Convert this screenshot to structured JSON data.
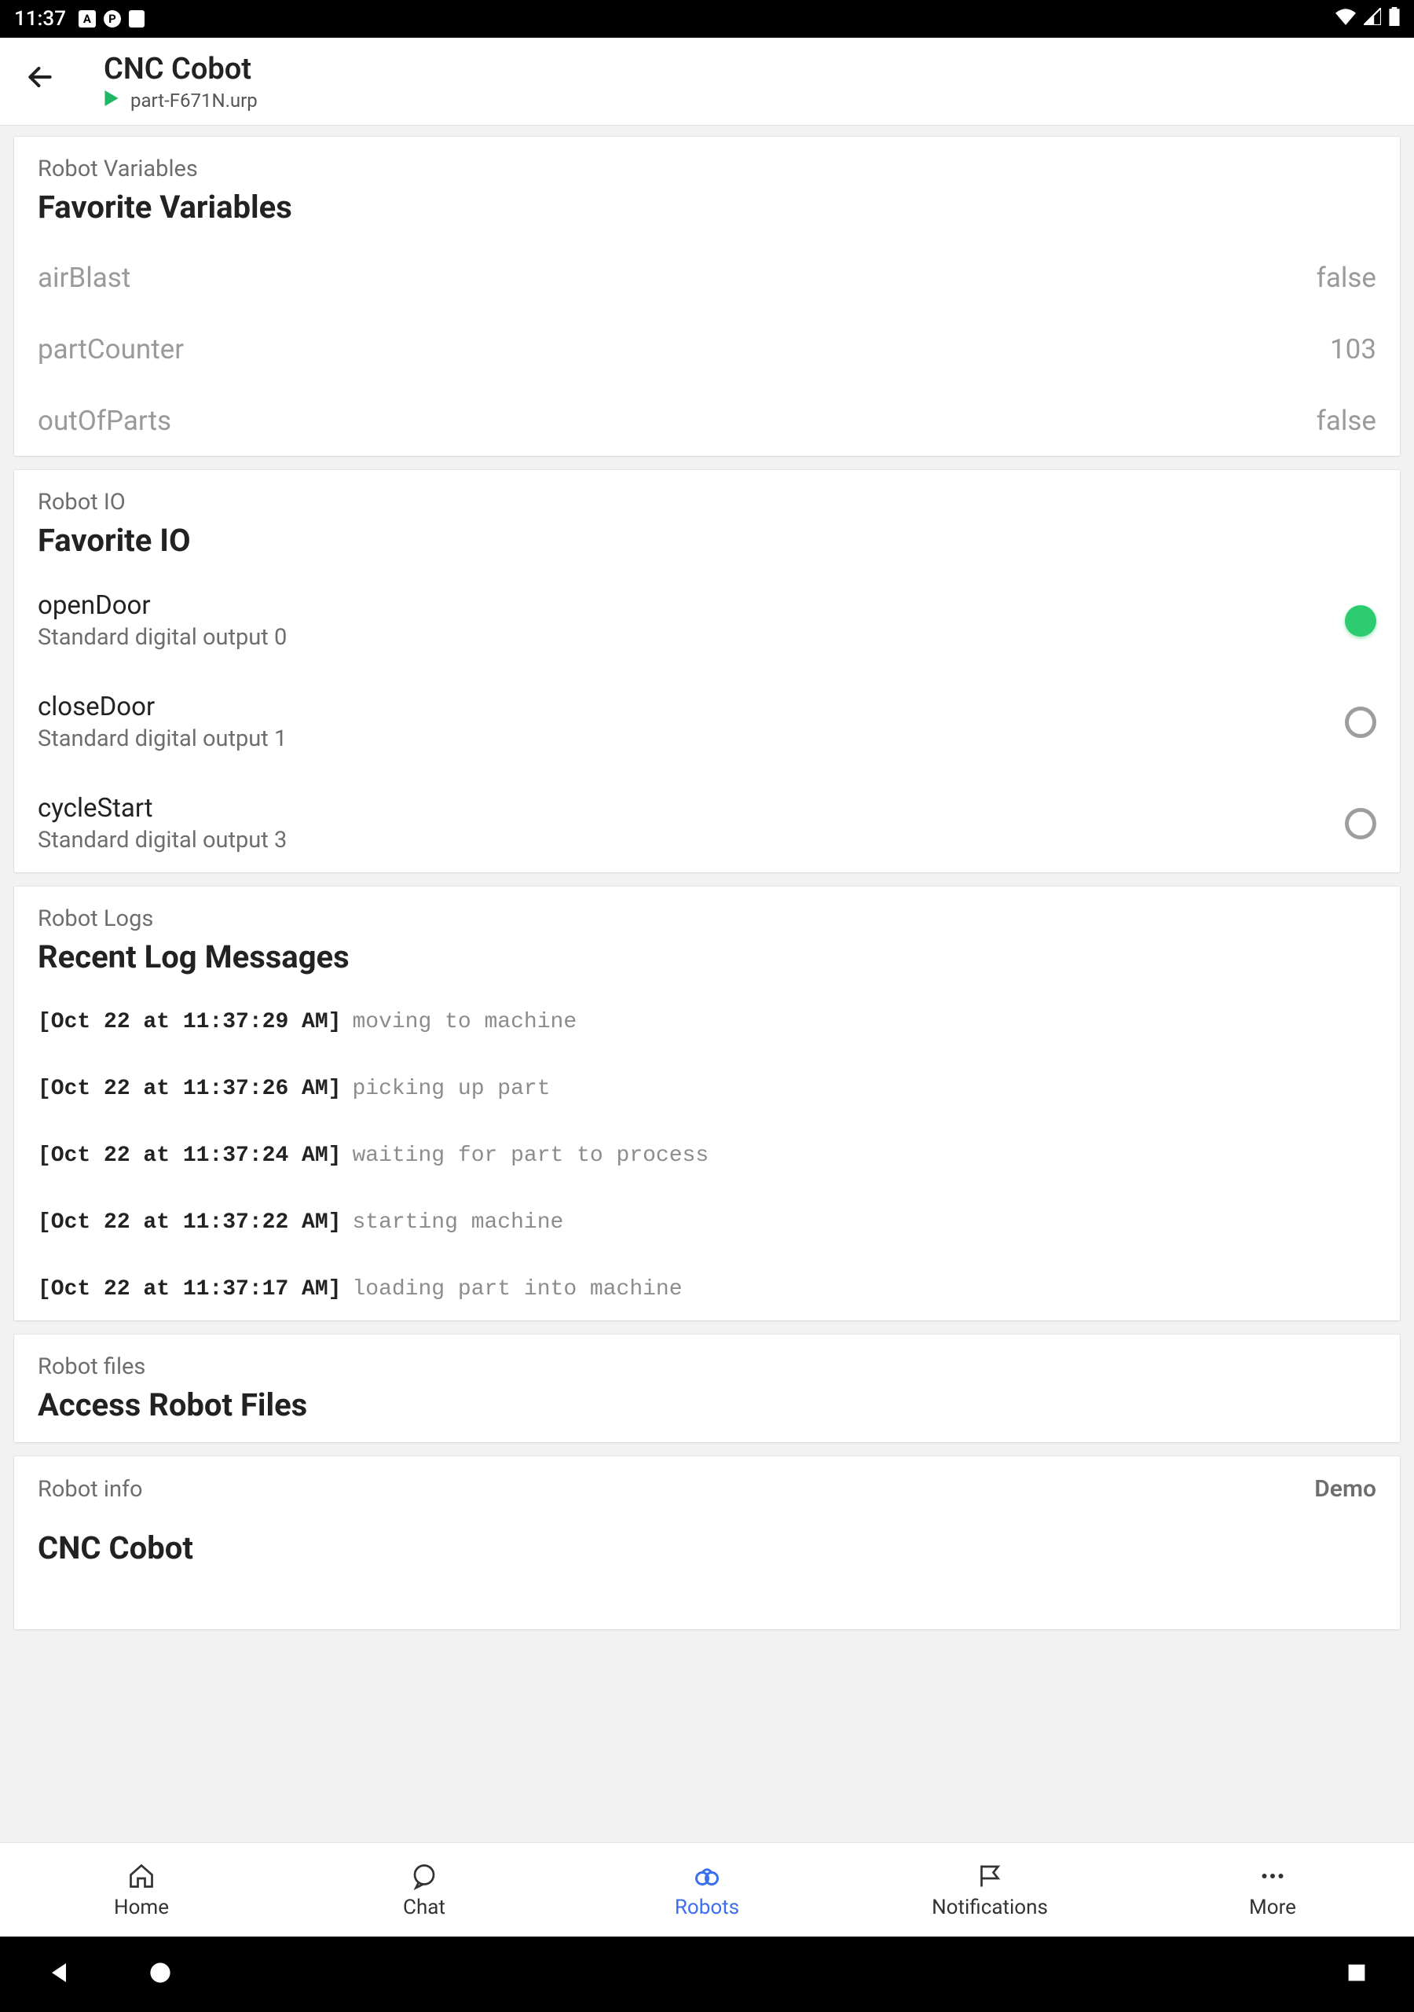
{
  "status": {
    "time": "11:37"
  },
  "header": {
    "title": "CNC Cobot",
    "filename": "part-F671N.urp"
  },
  "variables": {
    "section_label": "Robot Variables",
    "section_title": "Favorite Variables",
    "items": [
      {
        "name": "airBlast",
        "value": "false"
      },
      {
        "name": "partCounter",
        "value": "103"
      },
      {
        "name": "outOfParts",
        "value": "false"
      }
    ]
  },
  "io": {
    "section_label": "Robot IO",
    "section_title": "Favorite IO",
    "items": [
      {
        "name": "openDoor",
        "desc": "Standard digital output 0",
        "on": true
      },
      {
        "name": "closeDoor",
        "desc": "Standard digital output 1",
        "on": false
      },
      {
        "name": "cycleStart",
        "desc": "Standard digital output 3",
        "on": false
      }
    ]
  },
  "logs": {
    "section_label": "Robot Logs",
    "section_title": "Recent Log Messages",
    "items": [
      {
        "ts": "[Oct 22 at 11:37:29 AM]",
        "msg": "moving to machine"
      },
      {
        "ts": "[Oct 22 at 11:37:26 AM]",
        "msg": "picking up part"
      },
      {
        "ts": "[Oct 22 at 11:37:24 AM]",
        "msg": "waiting for part to process"
      },
      {
        "ts": "[Oct 22 at 11:37:22 AM]",
        "msg": "starting machine"
      },
      {
        "ts": "[Oct 22 at 11:37:17 AM]",
        "msg": "loading part into machine"
      }
    ]
  },
  "files": {
    "section_label": "Robot files",
    "section_title": "Access Robot Files"
  },
  "info": {
    "section_label": "Robot info",
    "demo_tag": "Demo",
    "title": "CNC Cobot"
  },
  "nav": {
    "items": [
      {
        "label": "Home"
      },
      {
        "label": "Chat"
      },
      {
        "label": "Robots"
      },
      {
        "label": "Notifications"
      },
      {
        "label": "More"
      }
    ]
  }
}
